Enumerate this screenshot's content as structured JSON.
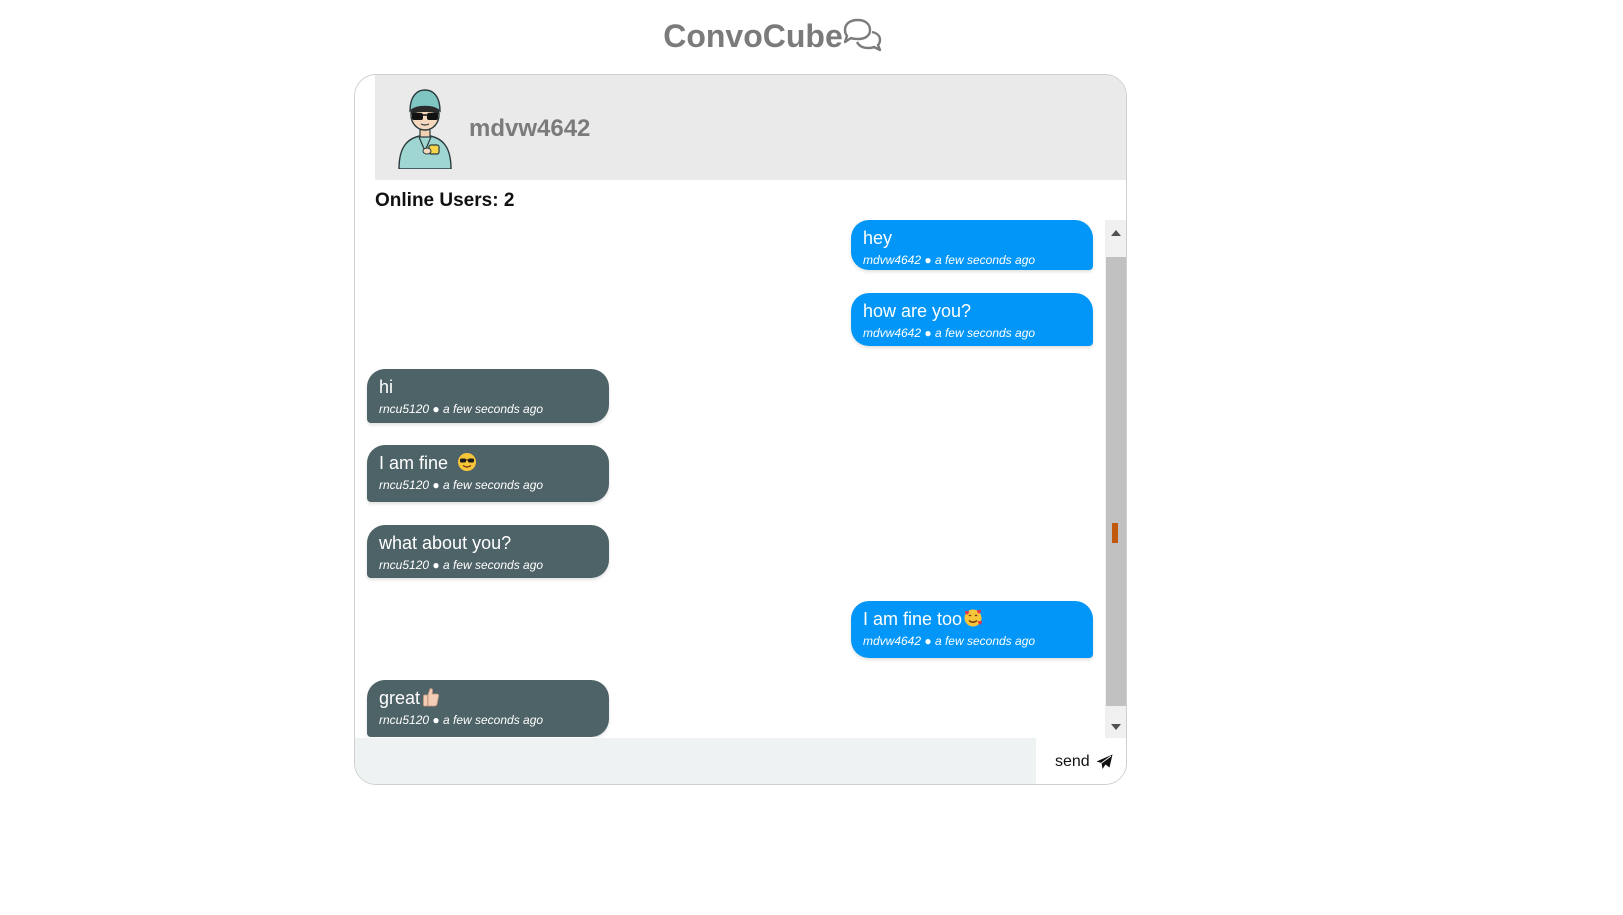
{
  "app": {
    "title": "ConvoCube"
  },
  "header": {
    "username": "mdvw4642"
  },
  "online": {
    "label": "Online Users: 2"
  },
  "messages": [
    {
      "text": "hey",
      "user": "mdvw4642",
      "time": "a few seconds ago",
      "mine": true
    },
    {
      "text": "how are you?",
      "user": "mdvw4642",
      "time": "a few seconds ago",
      "mine": true
    },
    {
      "text": "hi",
      "user": "rncu5120",
      "time": "a few seconds ago",
      "mine": false
    },
    {
      "text": "I am fine",
      "user": "rncu5120",
      "time": "a few seconds ago",
      "mine": false,
      "emoji": "sunglasses-face"
    },
    {
      "text": "what about you?",
      "user": "rncu5120",
      "time": "a few seconds ago",
      "mine": false
    },
    {
      "text": "I am fine too",
      "user": "mdvw4642",
      "time": "a few seconds ago",
      "mine": true,
      "emoji": "smiling-face-with-hearts"
    },
    {
      "text": "great",
      "user": "rncu5120",
      "time": "a few seconds ago",
      "mine": false,
      "emoji": "thumbs-up"
    }
  ],
  "meta_separator": "●",
  "composer": {
    "placeholder": "",
    "send_label": "send",
    "send_icon": "paper-plane-icon"
  },
  "colors": {
    "mine": "#0196f7",
    "other": "#4e6367",
    "title": "#7b7b7b",
    "header_bg": "#eaeaea"
  }
}
